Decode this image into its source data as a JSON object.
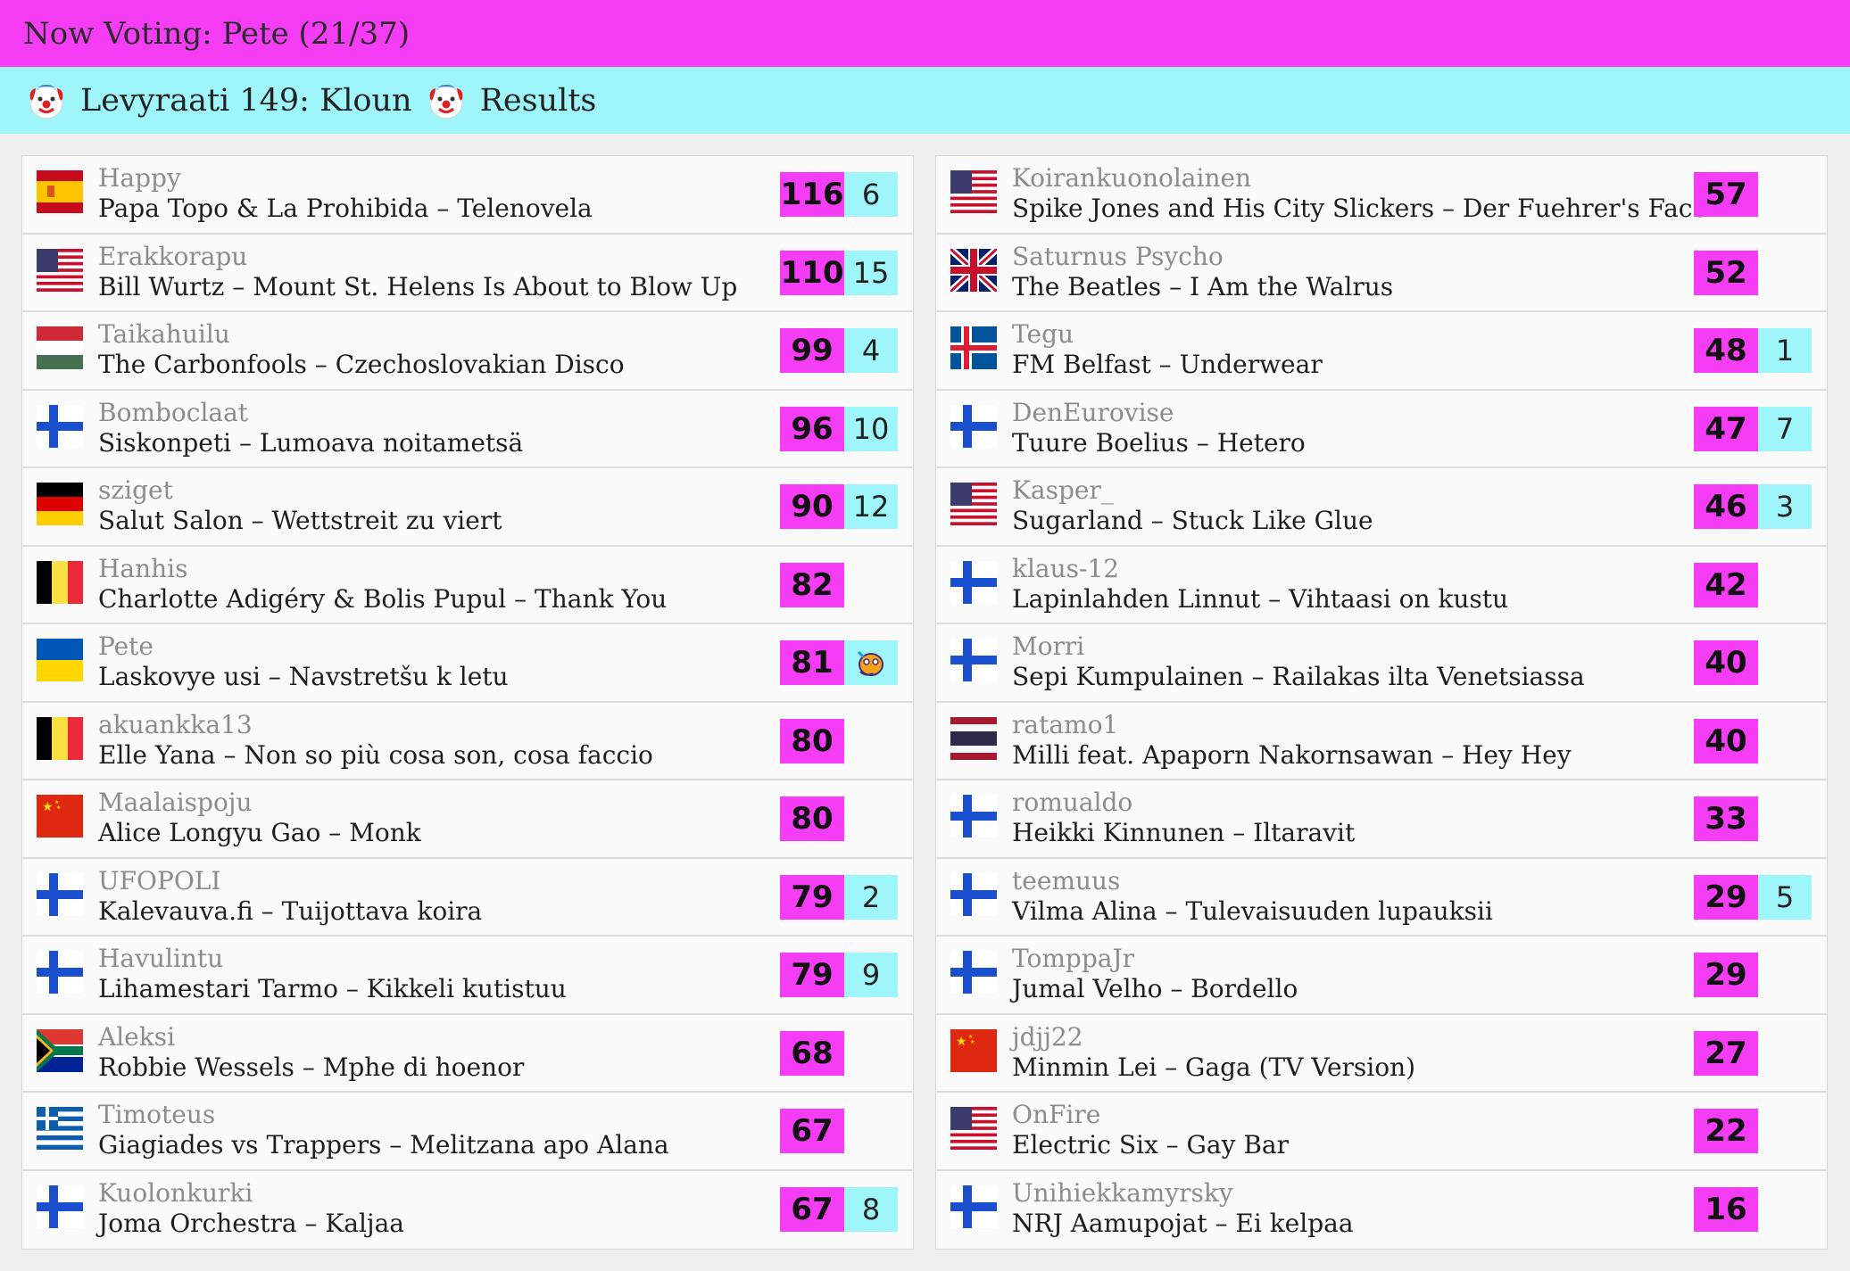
{
  "header": {
    "now_voting": "Now Voting: Pete (21/37)"
  },
  "subheader": {
    "title": "Levyraati 149: Kloun",
    "results": "Results"
  },
  "left": [
    {
      "flag": "es",
      "voter": "Happy",
      "song": "Papa Topo & La Prohibida – Telenovela",
      "score": "116",
      "points": "6"
    },
    {
      "flag": "us",
      "voter": "Erakkorapu",
      "song": "Bill Wurtz – Mount St. Helens Is About to Blow Up",
      "score": "110",
      "points": "15"
    },
    {
      "flag": "hu",
      "voter": "Taikahuilu",
      "song": "The Carbonfools – Czechoslovakian Disco",
      "score": "99",
      "points": "4"
    },
    {
      "flag": "fi",
      "voter": "Bomboclaat",
      "song": "Siskonpeti – Lumoava noitametsä",
      "score": "96",
      "points": "10"
    },
    {
      "flag": "de",
      "voter": "sziget",
      "song": "Salut Salon – Wettstreit zu viert",
      "score": "90",
      "points": "12"
    },
    {
      "flag": "be",
      "voter": "Hanhis",
      "song": "Charlotte Adigéry & Bolis Pupul – Thank You",
      "score": "82",
      "points": ""
    },
    {
      "flag": "ua",
      "voter": "Pete",
      "song": "Laskovye usi – Navstretšu k letu",
      "score": "81",
      "points": "",
      "emoji": "thinking"
    },
    {
      "flag": "be",
      "voter": "akuankka13",
      "song": "Elle Yana – Non so più cosa son, cosa faccio",
      "score": "80",
      "points": ""
    },
    {
      "flag": "cn",
      "voter": "Maalaispoju",
      "song": "Alice Longyu Gao – Monk",
      "score": "80",
      "points": ""
    },
    {
      "flag": "fi",
      "voter": "UFOPOLI",
      "song": "Kalevauva.fi – Tuijottava koira",
      "score": "79",
      "points": "2"
    },
    {
      "flag": "fi",
      "voter": "Havulintu",
      "song": "Lihamestari Tarmo – Kikkeli kutistuu",
      "score": "79",
      "points": "9"
    },
    {
      "flag": "za",
      "voter": "Aleksi",
      "song": "Robbie Wessels – Mphe di hoenor",
      "score": "68",
      "points": ""
    },
    {
      "flag": "gr",
      "voter": "Timoteus",
      "song": "Giagiades vs Trappers – Melitzana apo Alana",
      "score": "67",
      "points": ""
    },
    {
      "flag": "fi",
      "voter": "Kuolonkurki",
      "song": "Joma Orchestra – Kaljaa",
      "score": "67",
      "points": "8"
    }
  ],
  "right": [
    {
      "flag": "us",
      "voter": "Koirankuonolainen",
      "song": "Spike Jones and His City Slickers – Der Fuehrer's Face",
      "score": "57",
      "points": ""
    },
    {
      "flag": "gb",
      "voter": "Saturnus Psycho",
      "song": "The Beatles – I Am the Walrus",
      "score": "52",
      "points": ""
    },
    {
      "flag": "is",
      "voter": "Tegu",
      "song": "FM Belfast – Underwear",
      "score": "48",
      "points": "1"
    },
    {
      "flag": "fi",
      "voter": "DenEurovise",
      "song": "Tuure Boelius – Hetero",
      "score": "47",
      "points": "7"
    },
    {
      "flag": "us",
      "voter": "Kasper_",
      "song": "Sugarland – Stuck Like Glue",
      "score": "46",
      "points": "3"
    },
    {
      "flag": "fi",
      "voter": "klaus-12",
      "song": "Lapinlahden Linnut – Vihtaasi on kustu",
      "score": "42",
      "points": ""
    },
    {
      "flag": "fi",
      "voter": "Morri",
      "song": "Sepi Kumpulainen – Railakas ilta Venetsiassa",
      "score": "40",
      "points": ""
    },
    {
      "flag": "th",
      "voter": "ratamo1",
      "song": "Milli feat. Apaporn Nakornsawan – Hey Hey",
      "score": "40",
      "points": ""
    },
    {
      "flag": "fi",
      "voter": "romualdo",
      "song": "Heikki Kinnunen – Iltaravit",
      "score": "33",
      "points": ""
    },
    {
      "flag": "fi",
      "voter": "teemuus",
      "song": "Vilma Alina – Tulevaisuuden lupauksii",
      "score": "29",
      "points": "5"
    },
    {
      "flag": "fi",
      "voter": "TomppaJr",
      "song": "Jumal Velho – Bordello",
      "score": "29",
      "points": ""
    },
    {
      "flag": "cn",
      "voter": "jdjj22",
      "song": "Minmin Lei – Gaga (TV Version)",
      "score": "27",
      "points": ""
    },
    {
      "flag": "us",
      "voter": "OnFire",
      "song": "Electric Six – Gay Bar",
      "score": "22",
      "points": ""
    },
    {
      "flag": "fi",
      "voter": "Unihiekkamyrsky",
      "song": "NRJ Aamupojat – Ei kelpaa",
      "score": "16",
      "points": ""
    }
  ]
}
